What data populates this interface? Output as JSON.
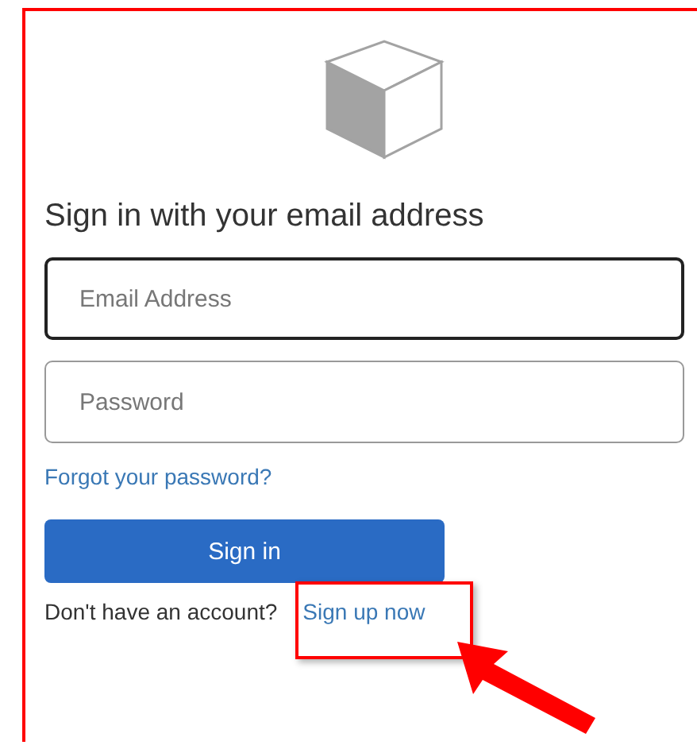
{
  "heading": "Sign in with your email address",
  "fields": [
    {
      "placeholder": "Email Address",
      "focused": true
    },
    {
      "placeholder": "Password",
      "focused": false
    }
  ],
  "forgot_link": "Forgot your password?",
  "sign_in_button": "Sign in",
  "signup_prompt": "Don't have an account?",
  "signup_link": "Sign up now"
}
